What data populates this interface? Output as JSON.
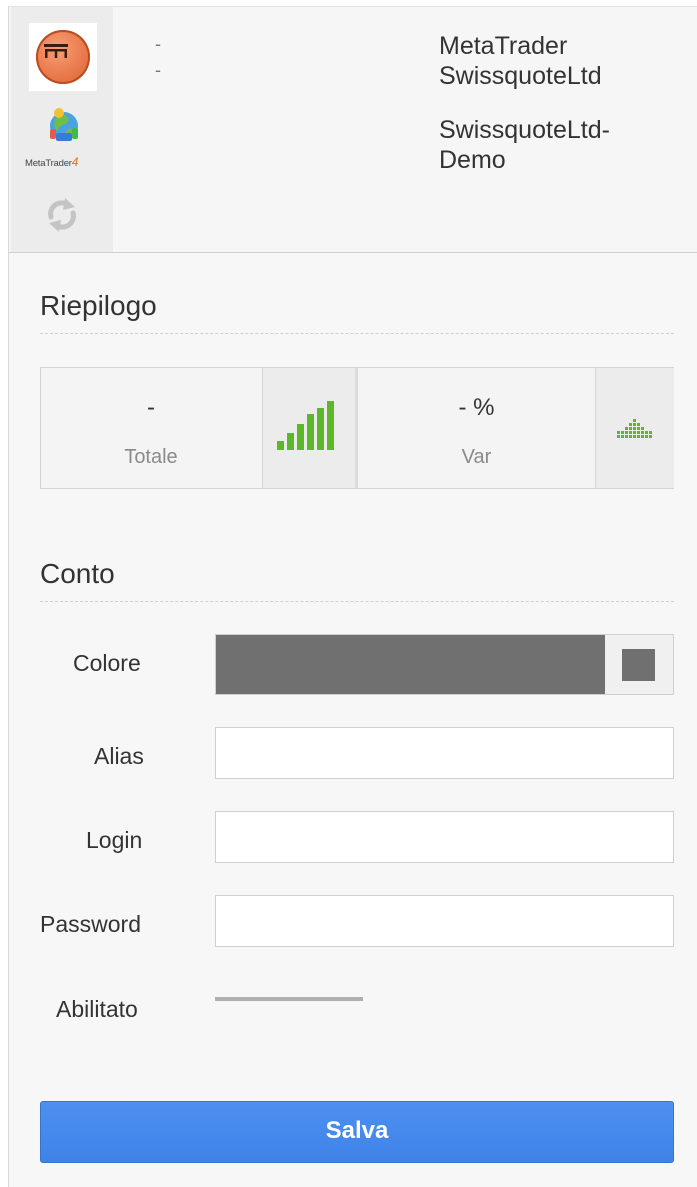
{
  "header": {
    "dash_1": "-",
    "dash_2": "-",
    "platform_line1": "MetaTrader",
    "platform_line2": "SwissquoteLtd",
    "server_line1": "SwissquoteLtd-",
    "server_line2": "Demo",
    "mt4_label": "MetaTrader",
    "mt4_label_num": "4"
  },
  "summary": {
    "title": "Riepilogo",
    "total_value": "-",
    "total_label": "Totale",
    "var_value": "- %",
    "var_label": "Var",
    "accent_color": "#5cb82a"
  },
  "account": {
    "title": "Conto",
    "color_label": "Colore",
    "color_value": "#707070",
    "alias_label": "Alias",
    "alias_value": "",
    "login_label": "Login",
    "login_value": "",
    "password_label": "Password",
    "password_value": "",
    "enabled_label": "Abilitato"
  },
  "actions": {
    "save_label": "Salva",
    "save_color": "#4288ec"
  },
  "icons": {
    "platform_logo": "metatrader-logo-icon",
    "mt4_logo": "metatrader4-logo-icon",
    "refresh": "refresh-icon",
    "total_chart": "bar-chart-icon",
    "var_chart": "dot-pyramid-icon",
    "color_picker": "color-swatch-icon"
  }
}
